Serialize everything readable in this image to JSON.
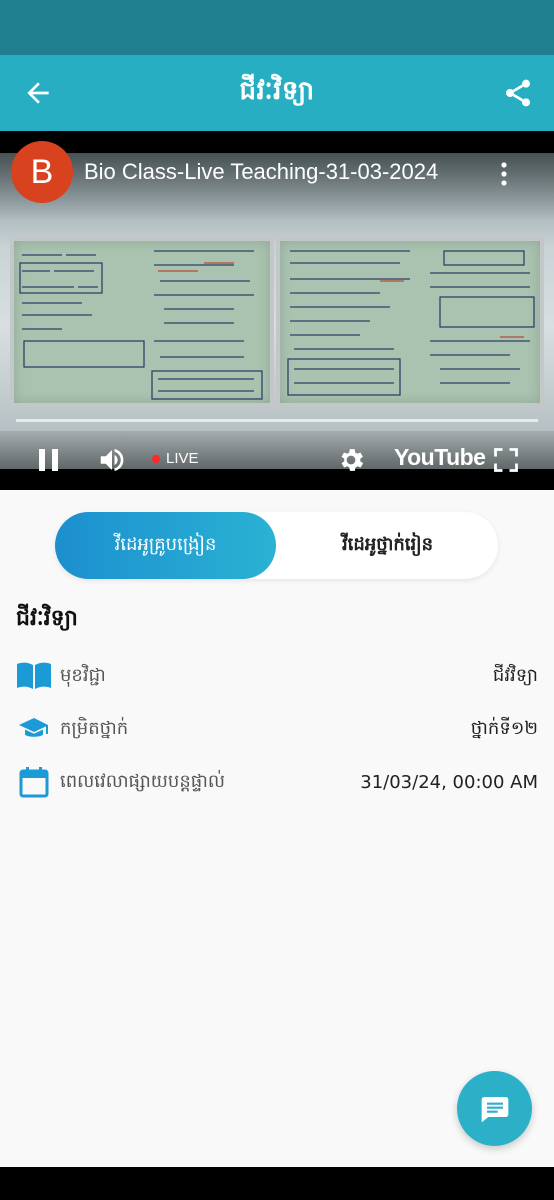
{
  "app_bar": {
    "title": "ជីវៈវិទ្យា",
    "back_icon": "arrow-left-icon",
    "share_icon": "share-icon"
  },
  "video": {
    "channel_initial": "B",
    "title": "Bio Class-Live Teaching-31-03-2024",
    "live_label": "LIVE",
    "youtube_label": "YouTube"
  },
  "tabs": [
    {
      "label": "វីដេអូគ្រូបង្រៀន",
      "active": true
    },
    {
      "label": "វីដេអូថ្នាក់រៀន",
      "active": false
    }
  ],
  "lesson": {
    "title": "ជីវៈវិទ្យា",
    "rows": [
      {
        "icon": "book-icon",
        "label": "មុខវិជ្ជា",
        "value": "ជីវវិទ្យា"
      },
      {
        "icon": "graduation-cap-icon",
        "label": "កម្រិតថ្នាក់",
        "value": "ថ្នាក់ទី១២"
      },
      {
        "icon": "calendar-icon",
        "label": "ពេលវេលាផ្សាយបន្តផ្ទាល់",
        "value": "31/03/24, 00:00 AM"
      }
    ]
  },
  "colors": {
    "status_bar": "#1f7f8e",
    "app_bar": "#28aec3",
    "accent": "#1c8fcf",
    "icon_blue": "#1b9ad6",
    "fab": "#2cb0c8"
  },
  "fab_icon": "chat-icon"
}
